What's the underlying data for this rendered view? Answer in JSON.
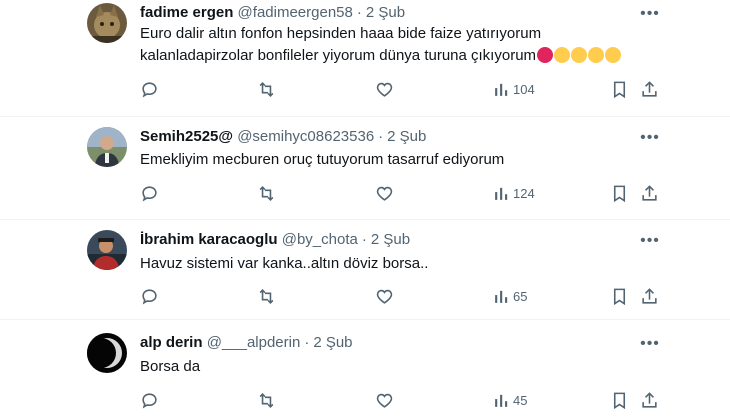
{
  "tweets": [
    {
      "name": "fadime ergen",
      "handle": "@fadimeergen58",
      "separator": "·",
      "time": "2 Şub",
      "text_line1": "Euro dalir altın fonfon hepsinden haaa bide faize yatırıyorum",
      "text_line2": "kalanladapirzolar bonfileler yiyorum dünya turuna çıkıyorum",
      "emojis": [
        "angry-face-emoji",
        "confounded-face-emoji",
        "relieved-face-emoji",
        "thinking-face-emoji",
        "shushing-face-emoji"
      ],
      "views": "104",
      "more": "•••"
    },
    {
      "name": "Semih2525@",
      "handle": "@semihyc08623536",
      "separator": "·",
      "time": "2 Şub",
      "text_line1": "Emekliyim mecburen oruç tutuyorum tasarruf ediyorum",
      "views": "124",
      "more": "•••"
    },
    {
      "name": "İbrahim karacaoglu",
      "handle": "@by_chota",
      "separator": "·",
      "time": "2 Şub",
      "text_line1": "Havuz sistemi var kanka..altın döviz borsa..",
      "views": "65",
      "more": "•••"
    },
    {
      "name": "alp derin",
      "handle": "@___alpderin",
      "separator": "·",
      "time": "2 Şub",
      "text_line1": "Borsa da",
      "views": "45",
      "more": "•••"
    }
  ],
  "colors": {
    "text": "#0f1419",
    "secondary": "#536471",
    "divider": "#eff3f4",
    "emoji_angry": "#e0245e",
    "emoji_yellow": "#ffcc4d"
  },
  "icons": [
    "reply-icon",
    "retweet-icon",
    "like-icon",
    "views-icon",
    "bookmark-icon",
    "share-icon",
    "more-icon"
  ]
}
